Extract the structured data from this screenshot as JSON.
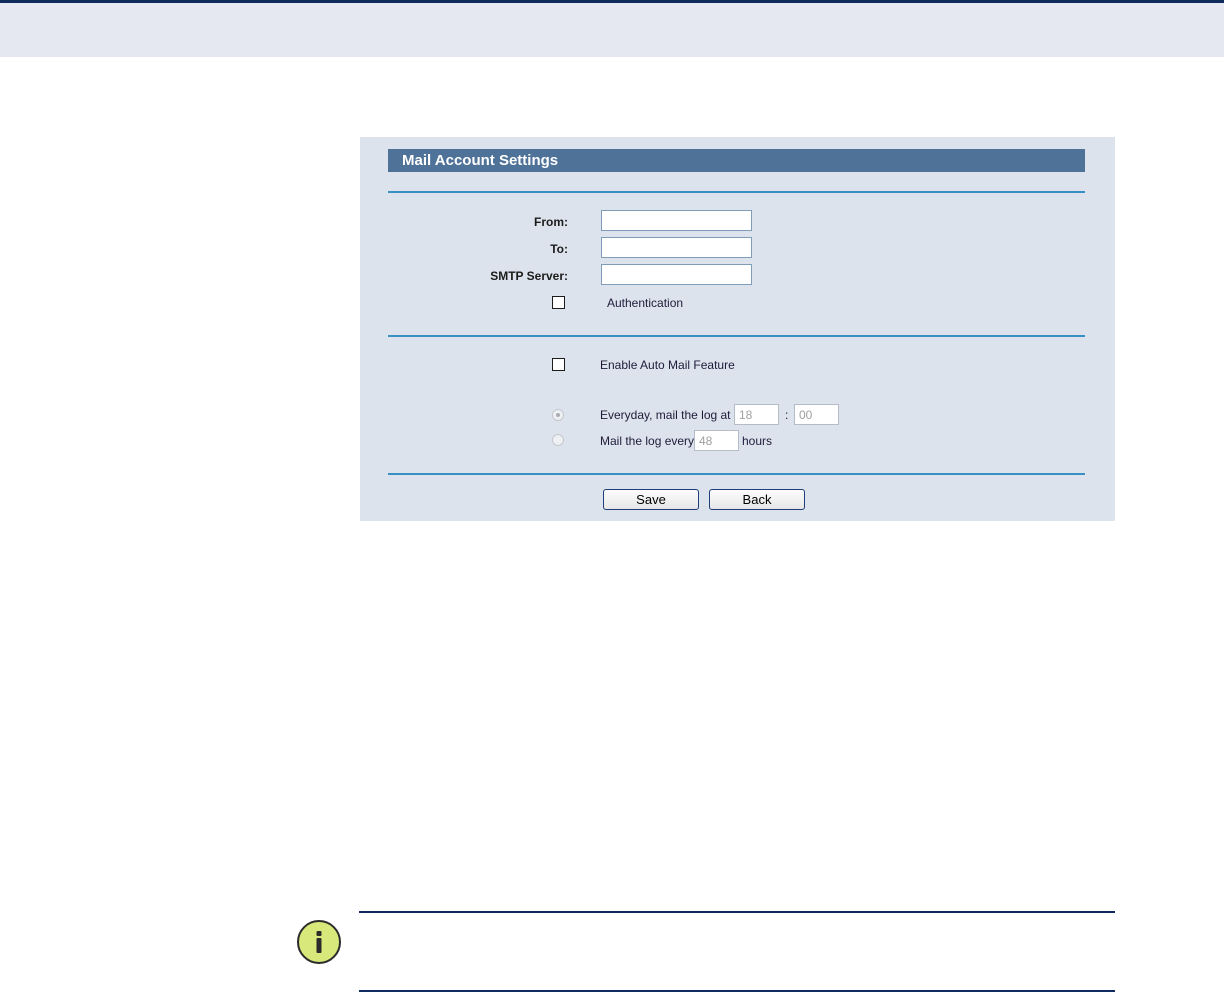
{
  "panel": {
    "title": "Mail Account Settings",
    "from_label": "From:",
    "from_value": "",
    "to_label": "To:",
    "to_value": "",
    "smtp_label": "SMTP Server:",
    "smtp_value": "",
    "authentication_label": "Authentication",
    "authentication_checked": false,
    "auto_mail_label": "Enable Auto Mail Feature",
    "auto_mail_checked": false,
    "everyday_label": "Everyday, mail the log at",
    "everyday_hour": "18",
    "time_separator": ":",
    "everyday_minute": "00",
    "interval_label": "Mail the log every",
    "interval_hours": "48",
    "hours_unit": "hours",
    "save_label": "Save",
    "back_label": "Back"
  },
  "colors": {
    "header": "#4f7299",
    "panel_bg": "#dde3ec",
    "rule": "#3a8fc2",
    "navy": "#0f2a5c",
    "info_icon": "#d8e87a"
  }
}
